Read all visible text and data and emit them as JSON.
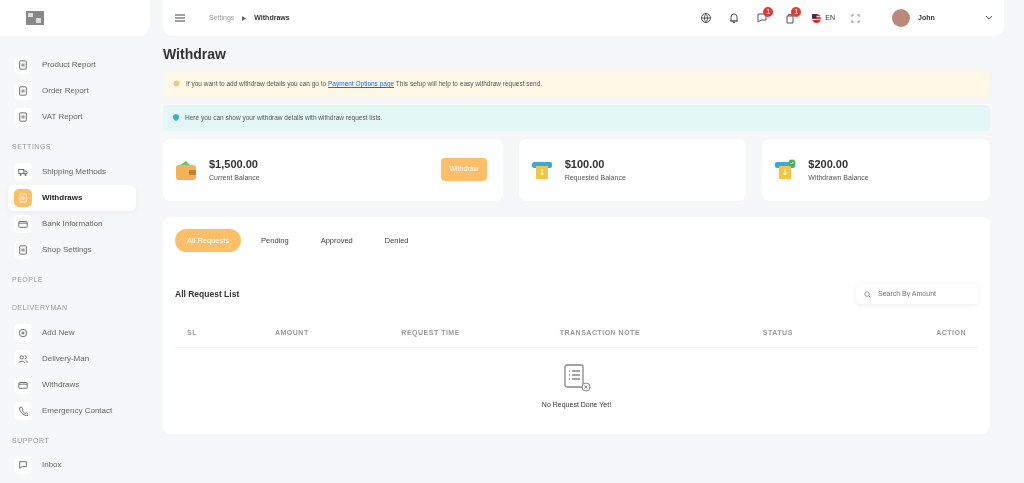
{
  "breadcrumb": [
    "Settings",
    "Withdraws"
  ],
  "header": {
    "language": "EN",
    "user_name": "John",
    "badges": [
      {
        "count": "1"
      },
      {
        "count": "1"
      }
    ]
  },
  "sidebar": [
    {
      "kind": "item",
      "label": "Product Report",
      "selected": false
    },
    {
      "kind": "item",
      "label": "Order Report",
      "selected": false
    },
    {
      "kind": "item",
      "label": "VAT Report",
      "selected": false
    },
    {
      "kind": "heading",
      "label": "SETTINGS"
    },
    {
      "kind": "item",
      "label": "Shipping Methods",
      "selected": false
    },
    {
      "kind": "item",
      "label": "Withdraws",
      "selected": true
    },
    {
      "kind": "item",
      "label": "Bank Information",
      "selected": false
    },
    {
      "kind": "item",
      "label": "Shop Settings",
      "selected": false
    },
    {
      "kind": "heading",
      "label": "PEOPLE"
    },
    {
      "kind": "heading",
      "label": "DELIVERYMAN"
    },
    {
      "kind": "item",
      "label": "Add New",
      "selected": false
    },
    {
      "kind": "item",
      "label": "Delivery-Man",
      "selected": false
    },
    {
      "kind": "item",
      "label": "Withdraws",
      "selected": false
    },
    {
      "kind": "item",
      "label": "Emergency Contact",
      "selected": false
    },
    {
      "kind": "heading",
      "label": "SUPPORT"
    },
    {
      "kind": "item",
      "label": "Inbox",
      "selected": false
    }
  ],
  "page_title": "Withdraw",
  "alerts": [
    {
      "kind": "warning",
      "before": "If you want to add withdraw details you can go to",
      "link": "Payment Options page",
      "after": "This setup will help to easy withdraw request send."
    },
    {
      "kind": "info",
      "text": "Here you can show your withdraw details with withdraw request lists."
    }
  ],
  "balances": [
    {
      "amount": "$1,500.00",
      "label": "Current Balance",
      "button": "Withdraw"
    },
    {
      "amount": "$100.00",
      "label": "Requested Balance"
    },
    {
      "amount": "$200.00",
      "label": "Withdrawn Balance"
    }
  ],
  "tabs": [
    {
      "label": "All Requests",
      "selected": true
    },
    {
      "label": "Pending",
      "selected": false
    },
    {
      "label": "Approved",
      "selected": false
    },
    {
      "label": "Denied",
      "selected": false
    }
  ],
  "list_title": "All Request List",
  "search": {
    "placeholder": "Search By Amount"
  },
  "table": {
    "columns": [
      "SL",
      "AMOUNT",
      "REQUEST TIME",
      "TRANSACTION NOTE",
      "STATUS",
      "ACTION"
    ],
    "empty_message": "No Request Done Yet!"
  }
}
